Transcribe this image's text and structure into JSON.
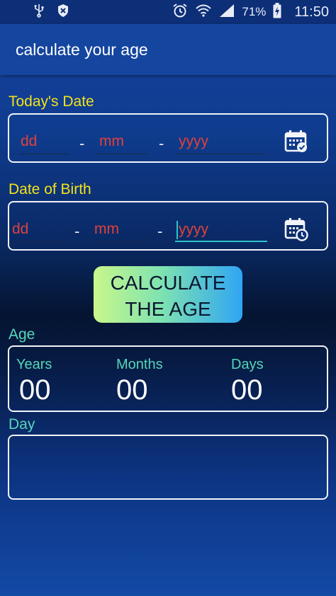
{
  "status_bar": {
    "battery_percent": "71%",
    "time": "11:50",
    "icons": [
      "usb-icon",
      "shield-icon",
      "alarm-icon",
      "wifi-icon",
      "signal-icon",
      "battery-charging-icon"
    ]
  },
  "app_bar": {
    "title": "calculate your age"
  },
  "todays_date": {
    "label": "Today's Date",
    "day_placeholder": "dd",
    "month_placeholder": "mm",
    "year_placeholder": "yyyy",
    "separator": "-",
    "icon": "calendar-check-icon"
  },
  "date_of_birth": {
    "label": "Date of Birth",
    "day_placeholder": "dd",
    "month_placeholder": "mm",
    "year_placeholder": "yyyy",
    "separator": "-",
    "icon": "calendar-clock-icon"
  },
  "calculate_button": {
    "line1": "CALCULATE",
    "line2": "THE AGE"
  },
  "age": {
    "label": "Age",
    "years_label": "Years",
    "years_value": "00",
    "months_label": "Months",
    "months_value": "00",
    "days_label": "Days",
    "days_value": "00"
  },
  "day": {
    "label": "Day",
    "value": ""
  },
  "colors": {
    "label_yellow": "#f4e21b",
    "label_teal": "#57d6b8",
    "placeholder_red": "#e0413b",
    "focus_teal": "#2ec2c9"
  }
}
